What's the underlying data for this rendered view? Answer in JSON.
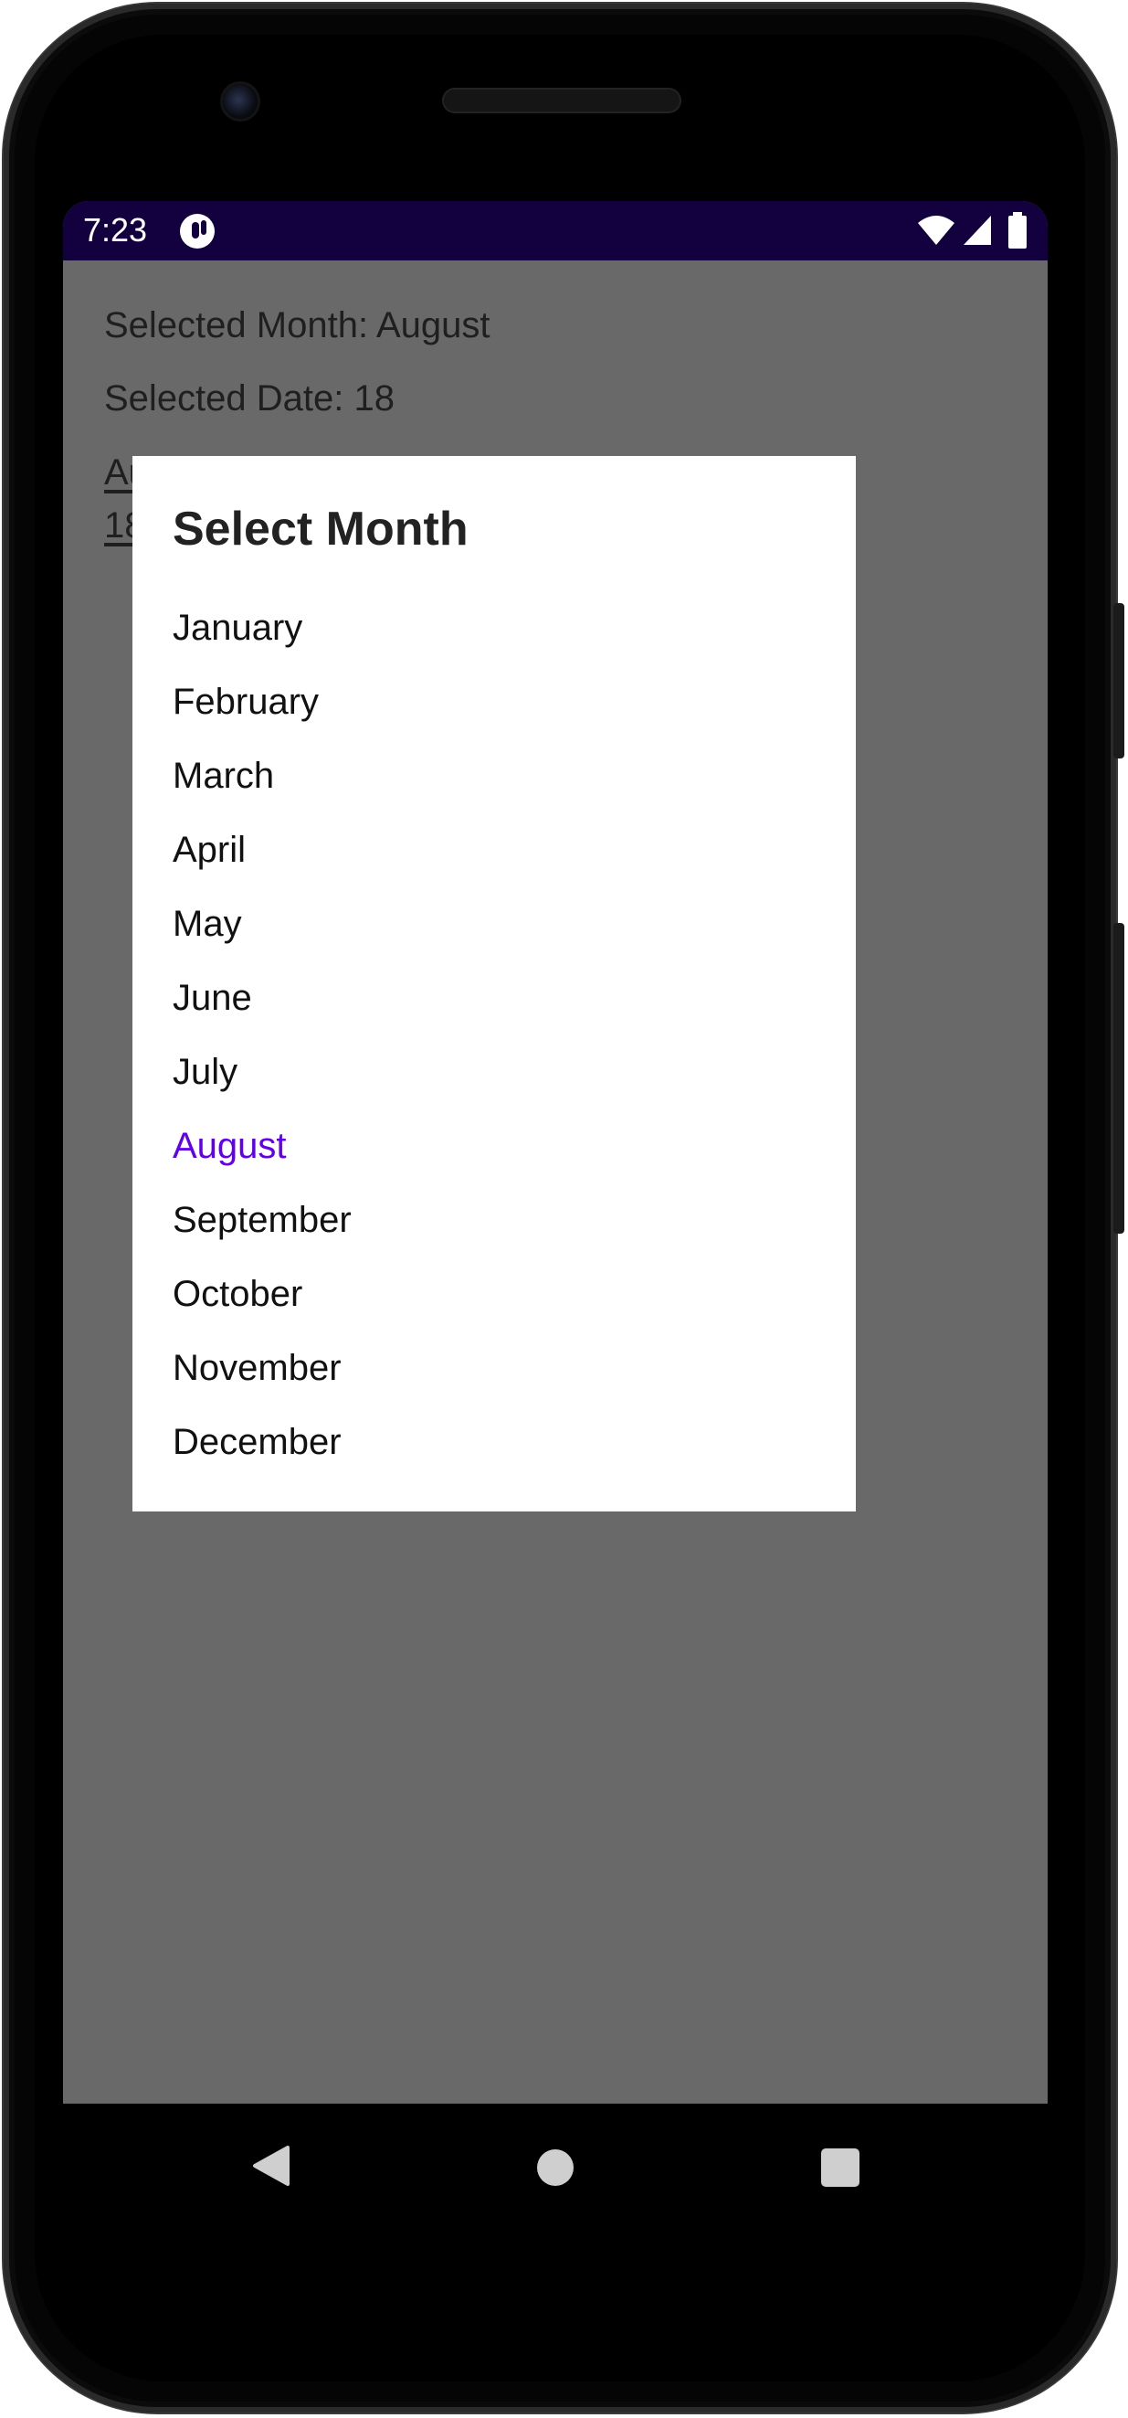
{
  "status_bar": {
    "time": "7:23",
    "icons": [
      "app-notification-icon",
      "wifi-icon",
      "cell-signal-icon",
      "battery-icon"
    ],
    "background": "#13003e"
  },
  "main": {
    "selected_month_text": "Selected Month: August",
    "selected_date_text": "Selected Date: 18",
    "month_link": "August",
    "date_link": "18"
  },
  "dialog": {
    "title": "Select Month",
    "selected_color": "#6200ee",
    "months": [
      "January",
      "February",
      "March",
      "April",
      "May",
      "June",
      "July",
      "August",
      "September",
      "October",
      "November",
      "December"
    ],
    "selected_month": "August"
  },
  "nav_bar": {
    "buttons": [
      "back-icon",
      "home-icon",
      "recents-icon"
    ]
  }
}
